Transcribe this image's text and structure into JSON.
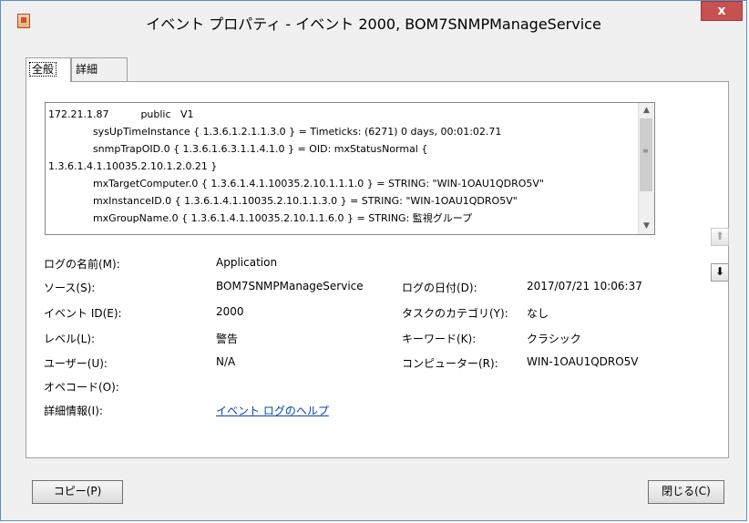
{
  "window": {
    "title": "イベント プロパティ - イベント 2000, BOM7SNMPManageService",
    "close_label": "x"
  },
  "tabs": [
    {
      "label": "全般"
    },
    {
      "label": "詳細"
    }
  ],
  "description": {
    "lines": [
      "172.21.1.87          public   V1",
      "              sysUpTimeInstance { 1.3.6.1.2.1.1.3.0 } = Timeticks: (6271) 0 days, 00:01:02.71",
      "              snmpTrapOID.0 { 1.3.6.1.6.3.1.1.4.1.0 } = OID: mxStatusNormal {",
      "1.3.6.1.4.1.10035.2.10.1.2.0.21 }",
      "              mxTargetComputer.0 { 1.3.6.1.4.1.10035.2.10.1.1.1.0 } = STRING: \"WIN-1OAU1QDRO5V\"",
      "              mxInstanceID.0 { 1.3.6.1.4.1.10035.2.10.1.1.3.0 } = STRING: \"WIN-1OAU1QDRO5V\"",
      "              mxGroupName.0 { 1.3.6.1.4.1.10035.2.10.1.1.6.0 } = STRING: 監視グループ"
    ]
  },
  "fields": {
    "log_name_label": "ログの名前(M):",
    "log_name_value": "Application",
    "source_label": "ソース(S):",
    "source_value": "BOM7SNMPManageService",
    "logged_label": "ログの日付(D):",
    "logged_value": "2017/07/21 10:06:37",
    "event_id_label": "イベント ID(E):",
    "event_id_value": "2000",
    "task_label": "タスクのカテゴリ(Y):",
    "task_value": "なし",
    "level_label": "レベル(L):",
    "level_value": "警告",
    "keywords_label": "キーワード(K):",
    "keywords_value": "クラシック",
    "user_label": "ユーザー(U):",
    "user_value": "N/A",
    "computer_label": "コンピューター(R):",
    "computer_value": "WIN-1OAU1QDRO5V",
    "opcode_label": "オペコード(O):",
    "more_info_label": "詳細情報(I):",
    "more_info_link": "イベント ログのヘルプ"
  },
  "buttons": {
    "copy": "コピー(P)",
    "close": "閉じる(C)"
  },
  "icons": {
    "up": "up-arrow-icon",
    "down": "down-arrow-icon",
    "app": "event-viewer-icon"
  },
  "colors": {
    "close_button": "#c75050",
    "link": "#0645ad",
    "border": "#5b8ec1"
  }
}
